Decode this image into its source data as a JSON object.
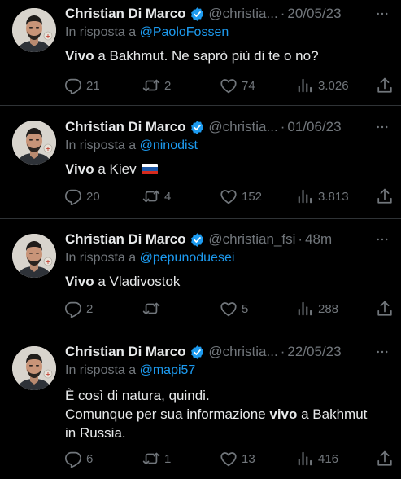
{
  "tweets": [
    {
      "author": "Christian Di Marco",
      "handle": "@christia...",
      "separator": "·",
      "time": "20/05/23",
      "reply_prefix": "In risposta a ",
      "reply_to": "@PaoloFossen",
      "text_bold": "Vivo",
      "text_rest": " a Bakhmut. Ne saprò più di te o no?",
      "replies": "21",
      "retweets": "2",
      "likes": "74",
      "views": "3.026"
    },
    {
      "author": "Christian Di Marco",
      "handle": "@christia...",
      "separator": "·",
      "time": "01/06/23",
      "reply_prefix": "In risposta a ",
      "reply_to": "@ninodist",
      "text_bold": "Vivo",
      "text_rest": " a Kiev ",
      "flag": "russia-flag",
      "replies": "20",
      "retweets": "4",
      "likes": "152",
      "views": "3.813"
    },
    {
      "author": "Christian Di Marco",
      "handle": "@christian_fsi",
      "separator": "·",
      "time": "48m",
      "reply_prefix": "In risposta a ",
      "reply_to": "@pepunoduesei",
      "text_bold": "Vivo",
      "text_rest": " a Vladivostok",
      "replies": "2",
      "retweets": "",
      "likes": "5",
      "views": "288"
    },
    {
      "author": "Christian Di Marco",
      "handle": "@christia...",
      "separator": "·",
      "time": "22/05/23",
      "reply_prefix": "In risposta a ",
      "reply_to": "@mapi57",
      "line1": "È così di natura, quindi.",
      "line2_pre": "Comunque per sua informazione ",
      "line2_bold": "vivo",
      "line2_post": " a Bakhmut",
      "line3": "in Russia.",
      "replies": "6",
      "retweets": "1",
      "likes": "13",
      "views": "416"
    }
  ],
  "colors": {
    "background": "#000000",
    "text": "#e7e9ea",
    "muted": "#71767b",
    "link": "#1d9bf0",
    "verified": "#1d9bf0",
    "divider": "#2f3336"
  },
  "icons": [
    "verified-badge-icon",
    "more-icon",
    "reply-icon",
    "retweet-icon",
    "like-icon",
    "views-icon",
    "share-icon"
  ]
}
